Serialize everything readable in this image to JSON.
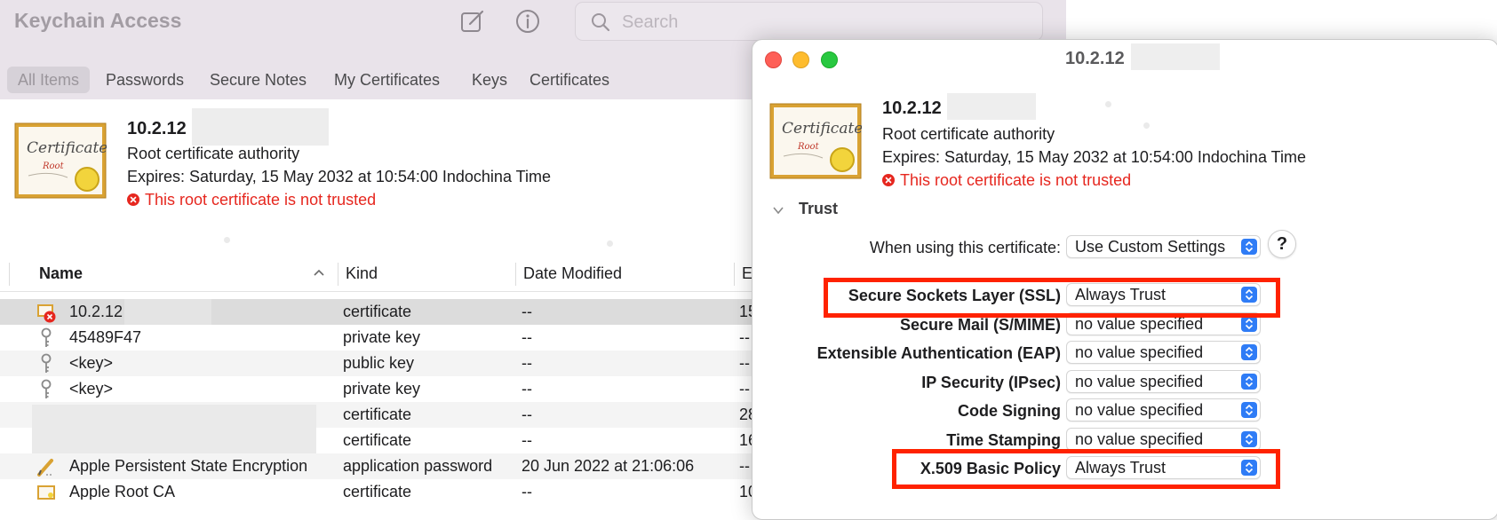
{
  "window": {
    "app_title": "Keychain Access",
    "search": {
      "placeholder": "Search"
    },
    "toolbar_icons": [
      "compose-icon",
      "info-icon"
    ],
    "tabs": [
      {
        "label": "All Items",
        "active": true
      },
      {
        "label": "Passwords"
      },
      {
        "label": "Secure Notes"
      },
      {
        "label": "My Certificates"
      },
      {
        "label": "Keys"
      },
      {
        "label": "Certificates"
      }
    ]
  },
  "detail": {
    "name": "10.2.12",
    "type": "Root certificate authority",
    "expires": "Expires: Saturday, 15 May 2032 at 10:54:00 Indochina Time",
    "warning": "This root certificate is not trusted"
  },
  "table": {
    "columns": [
      "Name",
      "Kind",
      "Date Modified",
      "E"
    ],
    "rows": [
      {
        "name": "10.2.12",
        "kind": "certificate",
        "date": "--",
        "expires": "15",
        "icon": "certificate-untrusted-icon"
      },
      {
        "name": "45489F47",
        "kind": "private key",
        "date": "--",
        "expires": "--",
        "icon": "key-icon"
      },
      {
        "name": "<key>",
        "kind": "public key",
        "date": "--",
        "expires": "--",
        "icon": "key-icon"
      },
      {
        "name": "<key>",
        "kind": "private key",
        "date": "--",
        "expires": "--",
        "icon": "key-icon"
      },
      {
        "name": "",
        "kind": "certificate",
        "date": "--",
        "expires": "28",
        "icon": ""
      },
      {
        "name": "",
        "kind": "certificate",
        "date": "--",
        "expires": "16",
        "icon": ""
      },
      {
        "name": "Apple Persistent State Encryption",
        "kind": "application password",
        "date": "20 Jun 2022 at 21:06:06",
        "expires": "--",
        "icon": "pencil-icon"
      },
      {
        "name": "Apple Root CA",
        "kind": "certificate",
        "date": "--",
        "expires": "10",
        "icon": "certificate-icon"
      }
    ]
  },
  "dialog": {
    "title": "10.2.12",
    "name": "10.2.12",
    "type": "Root certificate authority",
    "expires": "Expires: Saturday, 15 May 2032 at 10:54:00 Indochina Time",
    "warning": "This root certificate is not trusted",
    "trust": {
      "header": "Trust",
      "when_using_label": "When using this certificate:",
      "when_using_value": "Use Custom Settings",
      "help_label": "?",
      "settings": [
        {
          "label": "Secure Sockets Layer (SSL)",
          "value": "Always Trust"
        },
        {
          "label": "Secure Mail (S/MIME)",
          "value": "no value specified"
        },
        {
          "label": "Extensible Authentication (EAP)",
          "value": "no value specified"
        },
        {
          "label": "IP Security (IPsec)",
          "value": "no value specified"
        },
        {
          "label": "Code Signing",
          "value": "no value specified"
        },
        {
          "label": "Time Stamping",
          "value": "no value specified"
        },
        {
          "label": "X.509 Basic Policy",
          "value": "Always Trust"
        }
      ]
    }
  },
  "colors": {
    "warning_red": "#e6271f",
    "highlight_red": "#ff2200",
    "stepper_blue": "#2f7cf6",
    "traffic_close": "#fe5f57",
    "traffic_minimize": "#febc2e",
    "traffic_zoom": "#28c840"
  }
}
